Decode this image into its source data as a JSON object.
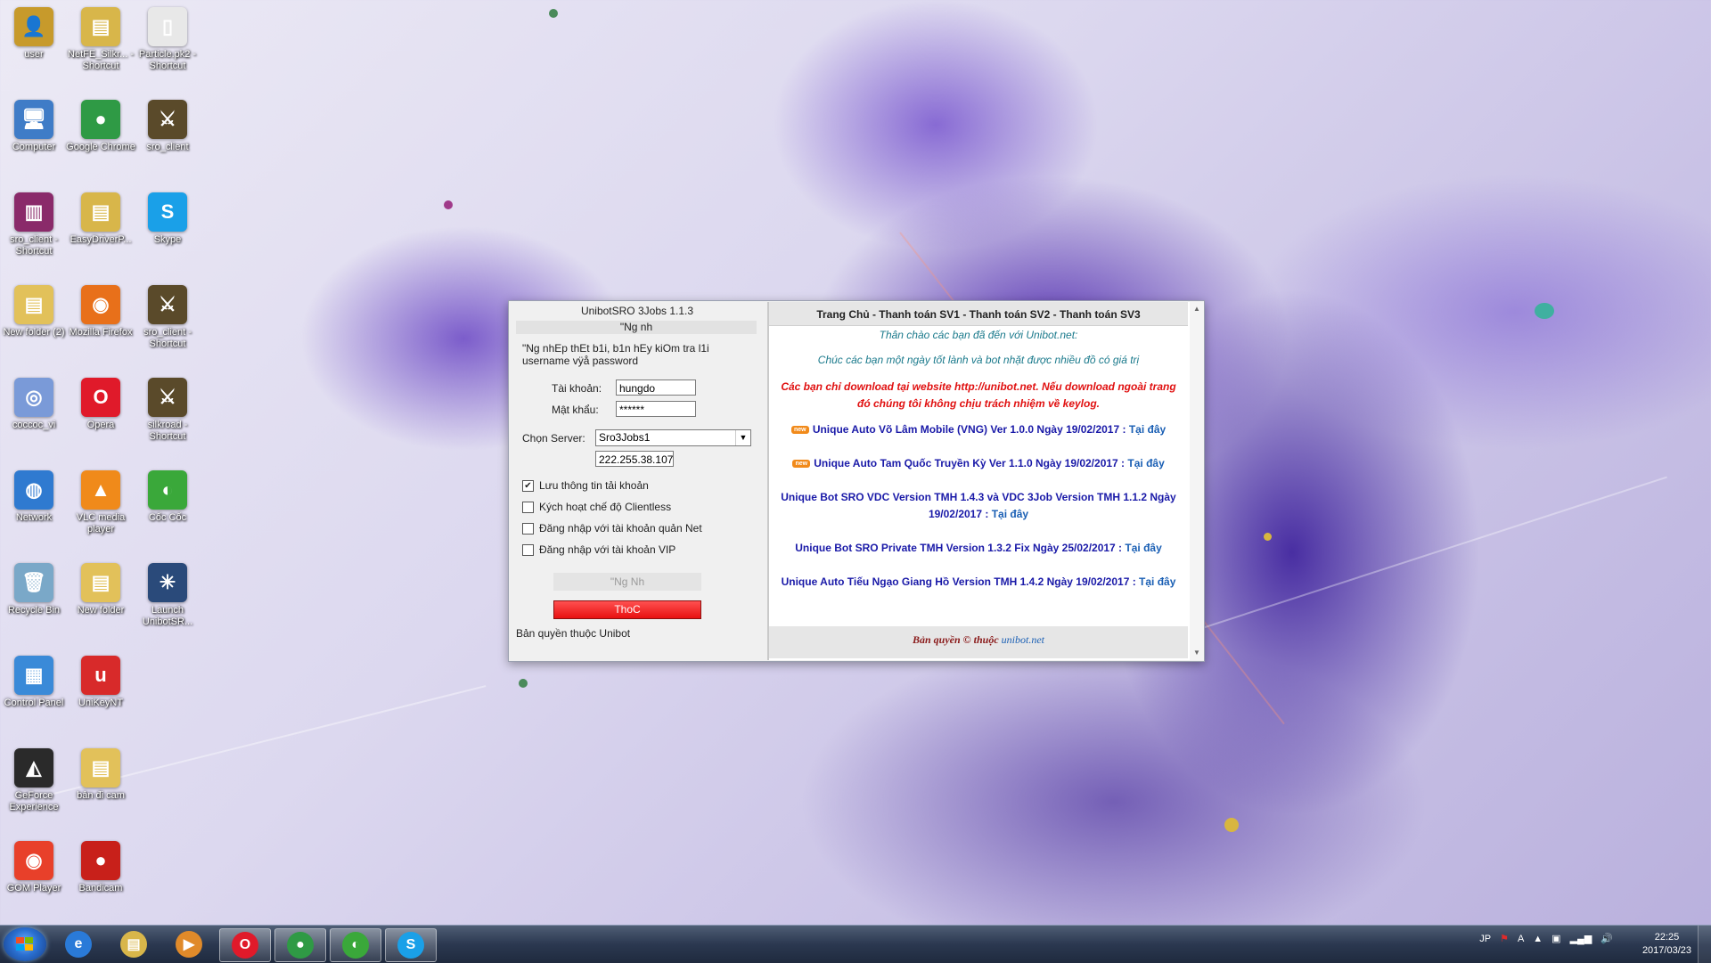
{
  "desktop": {
    "icons": [
      {
        "label": "user",
        "glyph": "👤",
        "color": "#c79a2b"
      },
      {
        "label": "NetFE_Silkr... - Shortcut",
        "glyph": "▤",
        "color": "#d8b64a"
      },
      {
        "label": "Particle.pk2 - Shortcut",
        "glyph": "▯",
        "color": "#e8e8e8"
      },
      {
        "label": "Computer",
        "glyph": "🖥",
        "color": "#3f7cc7"
      },
      {
        "label": "Google Chrome",
        "glyph": "●",
        "color": "#2f9a45"
      },
      {
        "label": "sro_client",
        "glyph": "⚔",
        "color": "#5a4a2a"
      },
      {
        "label": "sro_client - Shortcut",
        "glyph": "▥",
        "color": "#8a2a6a"
      },
      {
        "label": "EasyDriverP...",
        "glyph": "▤",
        "color": "#d8b64a"
      },
      {
        "label": "Skype",
        "glyph": "S",
        "color": "#1aa0e8"
      },
      {
        "label": "New folder (2)",
        "glyph": "▤",
        "color": "#e2c15a"
      },
      {
        "label": "Mozilla Firefox",
        "glyph": "◉",
        "color": "#e8701a"
      },
      {
        "label": "sro_client - Shortcut",
        "glyph": "⚔",
        "color": "#5a4a2a"
      },
      {
        "label": "coccoc_vi",
        "glyph": "◎",
        "color": "#7a9ad8"
      },
      {
        "label": "Opera",
        "glyph": "O",
        "color": "#e01a2a"
      },
      {
        "label": "silkroad - Shortcut",
        "glyph": "⚔",
        "color": "#5a4a2a"
      },
      {
        "label": "Network",
        "glyph": "◍",
        "color": "#2f7ad0"
      },
      {
        "label": "VLC media player",
        "glyph": "▲",
        "color": "#f08a1a"
      },
      {
        "label": "Cốc Cốc",
        "glyph": "◐",
        "color": "#3aa83a"
      },
      {
        "label": "Recycle Bin",
        "glyph": "🗑",
        "color": "#7aa8c8"
      },
      {
        "label": "New folder",
        "glyph": "▤",
        "color": "#e2c15a"
      },
      {
        "label": "Launch UnibotSR...",
        "glyph": "✳",
        "color": "#2a4a7a"
      },
      {
        "label": "Control Panel",
        "glyph": "▦",
        "color": "#3a8ad8"
      },
      {
        "label": "UniKeyNT",
        "glyph": "u",
        "color": "#d82a2a"
      },
      {
        "label": "GeForce Experience",
        "glyph": "◭",
        "color": "#2a2a2a"
      },
      {
        "label": "bản đi cam",
        "glyph": "▤",
        "color": "#e2c15a"
      },
      {
        "label": "GOM Player",
        "glyph": "◉",
        "color": "#e8402a"
      },
      {
        "label": "Bandicam",
        "glyph": "●",
        "color": "#c8201a"
      }
    ]
  },
  "app": {
    "title": "UnibotSRO 3Jobs 1.1.3",
    "subtitle": "\"Ng nh",
    "info": "\"Ng nhEp thEt b1i, b1n hEy kiOm tra l1i username vÿå password",
    "username_label": "Tài khoản:",
    "username_value": "hungdo",
    "password_label": "Mật khẩu:",
    "password_value": "******",
    "server_label": "Chọn Server:",
    "server_value": "Sro3Jobs1",
    "ip_value": "222.255.38.107",
    "checks": [
      {
        "label": "Lưu thông tin tải khoản",
        "checked": true
      },
      {
        "label": "Kých hoạt chế độ Clientless",
        "checked": false
      },
      {
        "label": "Đăng nhập với tài khoản quản Net",
        "checked": false
      },
      {
        "label": "Đăng nhập với tài khoản VIP",
        "checked": false
      }
    ],
    "login_button": "\"Ng Nh",
    "exit_button": "ThoC",
    "copyright": "Bản quyền thuộc Unibot",
    "web": {
      "nav": "Trang Chủ - Thanh toán SV1 - Thanh toán SV2 - Thanh toán SV3",
      "greeting": "Thân chào các bạn đã đến với Unibot.net:",
      "wish": "Chúc các bạn một ngày tốt lành và bot nhặt được nhiều đồ có giá trị",
      "warning": "Các bạn chỉ download tại website http://unibot.net. Nếu download ngoài trang đó chúng tôi không chịu trách nhiệm về keylog.",
      "new_badge": "new",
      "download_label": "Tại đây",
      "links": [
        {
          "text": "Unique Auto Võ Lâm Mobile (VNG) Ver 1.0.0 Ngày 19/02/2017 :",
          "new": true
        },
        {
          "text": "Unique Auto Tam Quốc Truyền Kỳ Ver 1.1.0 Ngày 19/02/2017 :",
          "new": true
        },
        {
          "text": "Unique Bot SRO VDC Version TMH 1.4.3 và VDC 3Job Version TMH 1.1.2 Ngày 19/02/2017 :",
          "new": false
        },
        {
          "text": "Unique Bot SRO Private TMH Version 1.3.2 Fix Ngày 25/02/2017 :",
          "new": false
        },
        {
          "text": "Unique Auto Tiếu Ngạo Giang Hồ Version TMH 1.4.2 Ngày 19/02/2017 :",
          "new": false
        }
      ],
      "footer": "Bản quyền © thuộc",
      "footer_site": "unibot.net"
    }
  },
  "taskbar": {
    "items": [
      {
        "name": "internet-explorer",
        "glyph": "e",
        "color": "#2a7ad8"
      },
      {
        "name": "file-explorer",
        "glyph": "▤",
        "color": "#d8b64a"
      },
      {
        "name": "media-player",
        "glyph": "▶",
        "color": "#e08a2a"
      },
      {
        "name": "opera",
        "glyph": "O",
        "color": "#e01a2a"
      },
      {
        "name": "chrome",
        "glyph": "●",
        "color": "#2f9a45"
      },
      {
        "name": "coccoc",
        "glyph": "◐",
        "color": "#3aa83a"
      },
      {
        "name": "skype",
        "glyph": "S",
        "color": "#1aa0e8"
      }
    ],
    "lang": "JP",
    "ime": "A",
    "time": "22:25",
    "date": "2017/03/23"
  }
}
